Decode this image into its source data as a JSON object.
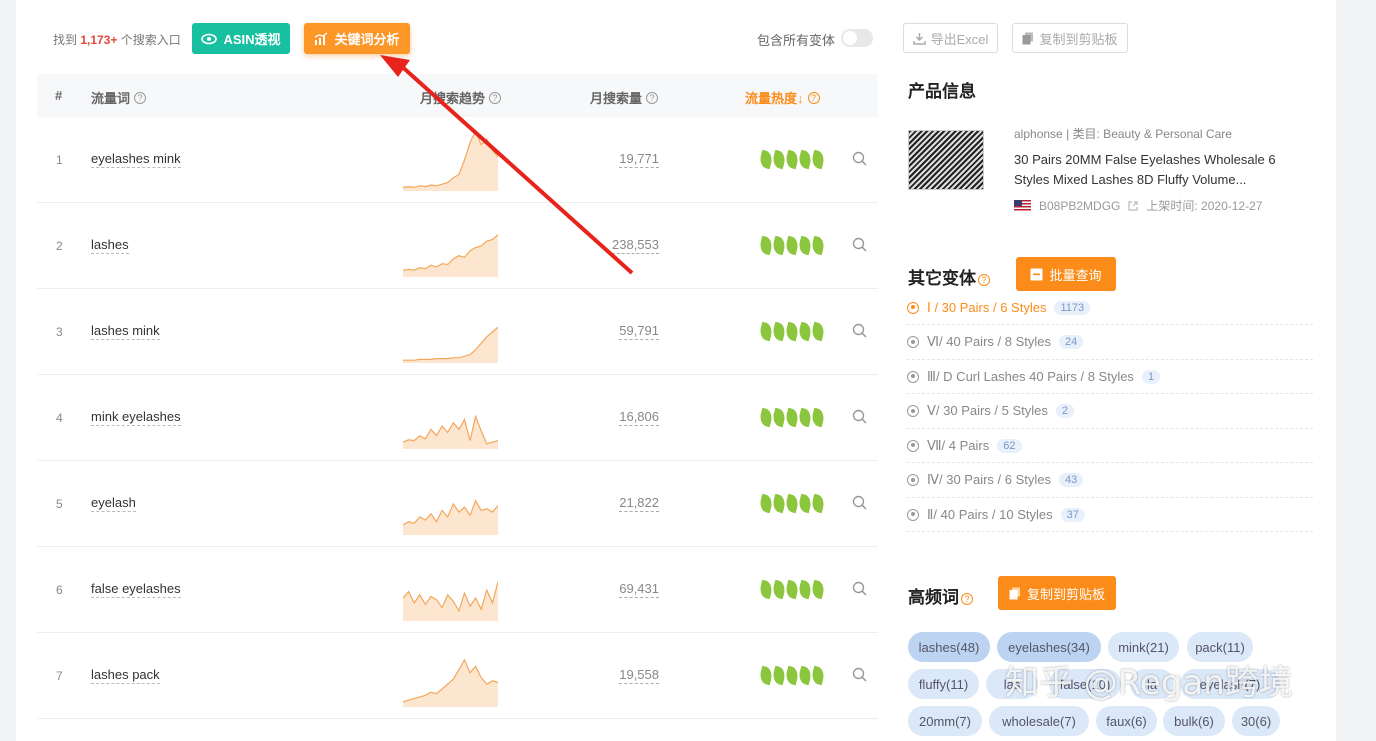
{
  "toolbar": {
    "found_prefix": "找到",
    "found_count": "1,173+",
    "found_suffix": "个搜索入口",
    "asin_button": "ASIN透视",
    "keyword_button": "关键词分析",
    "include_variants_label": "包含所有变体",
    "include_variants_on": false,
    "export_excel": "导出Excel",
    "copy_clipboard": "复制到剪贴板"
  },
  "table": {
    "headers": {
      "index": "#",
      "keyword": "流量词",
      "trend": "月搜索趋势",
      "volume": "月搜索量",
      "heat": "流量热度↓"
    },
    "rows": [
      {
        "idx": "1",
        "keyword": "eyelashes mink",
        "volume": "19,771",
        "heat": 5
      },
      {
        "idx": "2",
        "keyword": "lashes",
        "volume": "238,553",
        "heat": 5
      },
      {
        "idx": "3",
        "keyword": "lashes mink",
        "volume": "59,791",
        "heat": 5
      },
      {
        "idx": "4",
        "keyword": "mink eyelashes",
        "volume": "16,806",
        "heat": 5
      },
      {
        "idx": "5",
        "keyword": "eyelash",
        "volume": "21,822",
        "heat": 5
      },
      {
        "idx": "6",
        "keyword": "false eyelashes",
        "volume": "69,431",
        "heat": 5
      },
      {
        "idx": "7",
        "keyword": "lashes pack",
        "volume": "19,558",
        "heat": 5
      }
    ]
  },
  "product": {
    "section_title": "产品信息",
    "brand": "alphonse",
    "category": "类目: Beauty & Personal Care",
    "title": "30 Pairs 20MM False Eyelashes Wholesale 6 Styles Mixed Lashes 8D Fluffy Volume...",
    "asin": "B08PB2MDGG",
    "listed": "上架时间: 2020-12-27"
  },
  "variants": {
    "section_title": "其它变体",
    "batch_button": "批量查询",
    "items": [
      {
        "label": "Ⅰ / 30 Pairs / 6 Styles",
        "count": "1173",
        "active": true
      },
      {
        "label": "Ⅵ/ 40 Pairs / 8 Styles",
        "count": "24",
        "active": false
      },
      {
        "label": "Ⅲ/ D Curl Lashes 40 Pairs / 8 Styles",
        "count": "1",
        "active": false
      },
      {
        "label": "Ⅴ/ 30 Pairs / 5 Styles",
        "count": "2",
        "active": false
      },
      {
        "label": "Ⅶ/ 4 Pairs",
        "count": "62",
        "active": false
      },
      {
        "label": "Ⅳ/ 30 Pairs / 6 Styles",
        "count": "43",
        "active": false
      },
      {
        "label": "Ⅱ/ 40 Pairs / 10 Styles",
        "count": "37",
        "active": false
      }
    ]
  },
  "frequent": {
    "section_title": "高频词",
    "copy_button": "复制到剪贴板",
    "tags": [
      "lashes(48)",
      "eyelashes(34)",
      "mink(21)",
      "pack(11)",
      "fluffy(11)",
      "las",
      "false(10)",
      "la",
      "eyelash(7)",
      "20mm(7)",
      "wholesale(7)",
      "faux(6)",
      "bulk(6)",
      "30(6)"
    ]
  },
  "watermark": "知乎 @Regan跨境",
  "colors": {
    "accent_orange": "#fb8c1a",
    "teal": "#18c0a2",
    "leaf_green": "#8cc63f",
    "arrow_red": "#e8231b"
  }
}
